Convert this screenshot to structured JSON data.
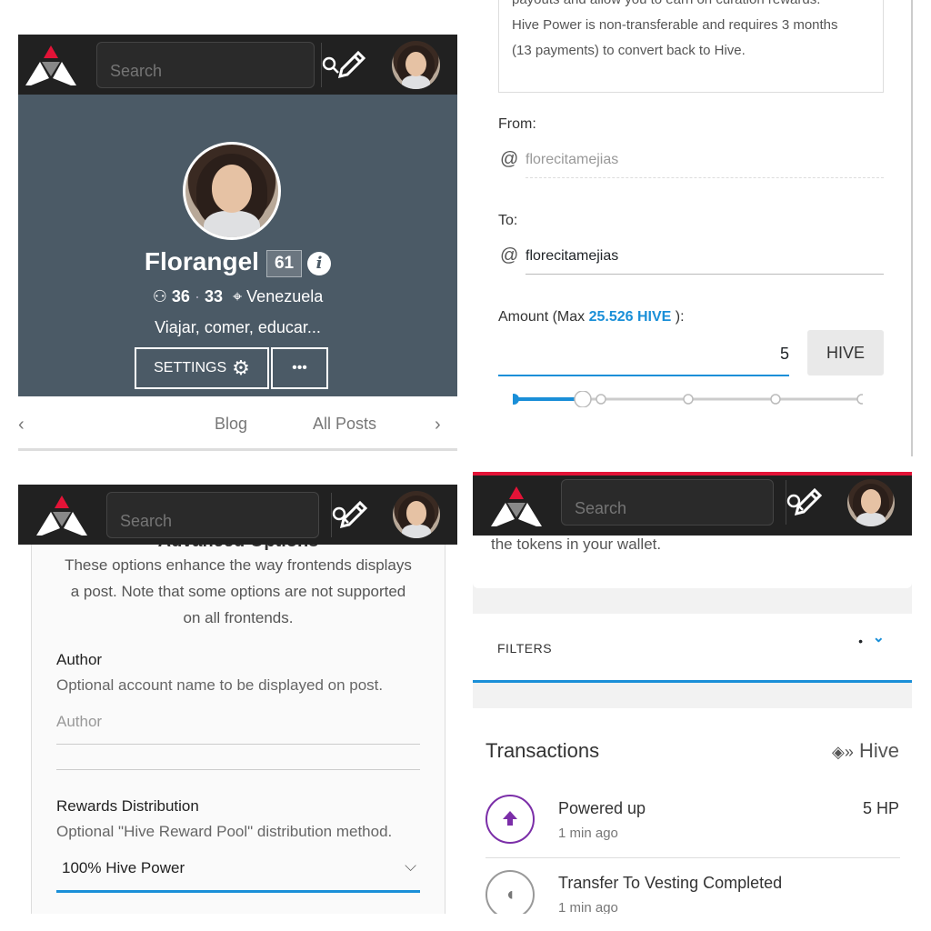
{
  "header": {
    "search_placeholder": "Search"
  },
  "profile": {
    "name": "Florangel",
    "reputation": "61",
    "followers": "36",
    "following": "33",
    "location": "Venezuela",
    "about": "Viajar, comer, educar...",
    "settings_label": "SETTINGS",
    "more_label": "•••",
    "tabs": [
      "Blog",
      "All Posts"
    ]
  },
  "power_up": {
    "note_line1": "payouts and allow you to earn on curation rewards.",
    "note_line2": "Hive Power is non-transferable and requires 3 months",
    "note_line3": "(13 payments) to convert back to Hive.",
    "from_label": "From:",
    "from_value": "florecitamejias",
    "to_label": "To:",
    "to_value": "florecitamejias",
    "amount_label": "Amount (Max ",
    "amount_max": "25.526 HIVE",
    "amount_close": " ):",
    "amount_value": "5",
    "currency": "HIVE",
    "slider_position": 0.2
  },
  "advanced": {
    "heading": "Advanced Options",
    "desc_line1": "These options enhance the way frontends displays",
    "desc_line2": "a post. Note that some options are not supported",
    "desc_line3": "on all frontends.",
    "author_label": "Author",
    "author_desc": "Optional account name to be displayed on post.",
    "author_placeholder": "Author",
    "rewards_label": "Rewards Distribution",
    "rewards_desc": "Optional \"Hive Reward Pool\" distribution method.",
    "rewards_value": "100% Hive Power"
  },
  "wallet": {
    "top_text": "the tokens in your wallet.",
    "filters_label": "FILTERS",
    "transactions_title": "Transactions",
    "hive_label": "Hive",
    "tx": [
      {
        "title": "Powered up",
        "time": "1 min ago",
        "amount": "5 HP"
      },
      {
        "title": "Transfer To Vesting Completed",
        "time": "1 min ago",
        "amount": ""
      }
    ]
  }
}
